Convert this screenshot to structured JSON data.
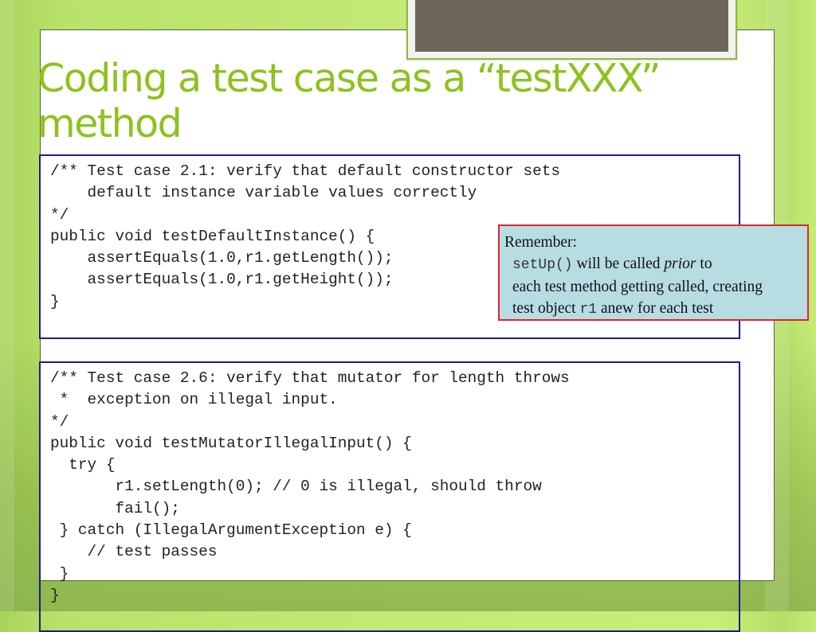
{
  "slide": {
    "title_line1": "Coding a test case as a “testXXX”",
    "title_line2": "method"
  },
  "code_block_1": {
    "lines": [
      "/** Test case 2.1: verify that default constructor sets",
      "    default instance variable values correctly",
      "*/",
      "public void testDefaultInstance() {",
      "    assertEquals(1.0,r1.getLength());",
      "    assertEquals(1.0,r1.getHeight());",
      "}"
    ]
  },
  "code_block_2": {
    "lines": [
      "/** Test case 2.6: verify that mutator for length throws",
      " *  exception on illegal input.",
      "*/",
      "public void testMutatorIllegalInput() {",
      "  try {",
      "       r1.setLength(0); // 0 is illegal, should throw",
      "       fail();",
      " } catch (IllegalArgumentException e) {",
      "    // test passes",
      " }",
      "}"
    ]
  },
  "callout": {
    "heading": "Remember:",
    "code_setup": "setUp()",
    "text_will_be_called": " will be called ",
    "text_prior": "prior",
    "text_to": " to",
    "line3": "each test method getting called, creating",
    "text_test_object": "test object ",
    "code_r1": "r1",
    "text_anew": " anew for each test"
  },
  "colors": {
    "title": "#8dc21f",
    "code_border": "#1a1f86",
    "callout_bg": "#b7dde3",
    "callout_border": "#e0252b",
    "photo": "#6d675a"
  }
}
